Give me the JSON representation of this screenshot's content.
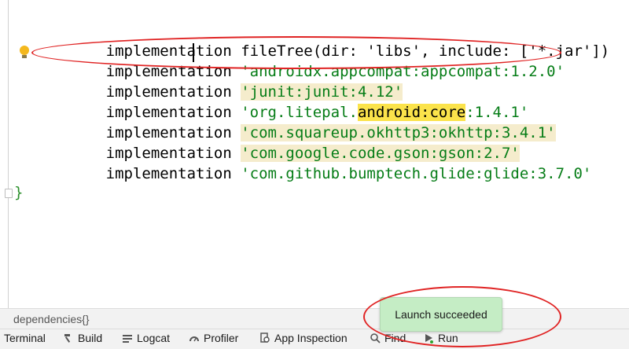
{
  "editor": {
    "lines": [
      {
        "kw": "implementation ",
        "rest": "fileTree(dir: 'libs', include: ['*.jar'])"
      },
      {
        "kw": "implementation ",
        "str": "'androidx.appcompat:appcompat:1.2.0'"
      },
      {
        "kw": "implementation ",
        "str": "'junit:junit:4.12'"
      },
      {
        "kw": "implementation ",
        "str_a": "'org.litepal.",
        "str_b": "android:core",
        "str_c": ":1.4.1'"
      },
      {
        "kw": "implementation ",
        "str": "'com.squareup.okhttp3:okhttp:3.4.1'"
      },
      {
        "kw": "implementation ",
        "str": "'com.google.code.gson:gson:2.7'"
      },
      {
        "kw": "implementation ",
        "str": "'com.github.bumptech.glide:glide:3.7.0'"
      }
    ],
    "closing_brace": "}"
  },
  "breadcrumb": {
    "text": "dependencies{}"
  },
  "toolbar": {
    "terminal": "Terminal",
    "build": "Build",
    "logcat": "Logcat",
    "profiler": "Profiler",
    "app_inspection": "App Inspection",
    "find": "Find",
    "run": "Run"
  },
  "toast": {
    "text": "Launch succeeded"
  },
  "colors": {
    "string": "#067d17",
    "annotation": "#e02424",
    "toast_bg": "#c5edc5"
  }
}
